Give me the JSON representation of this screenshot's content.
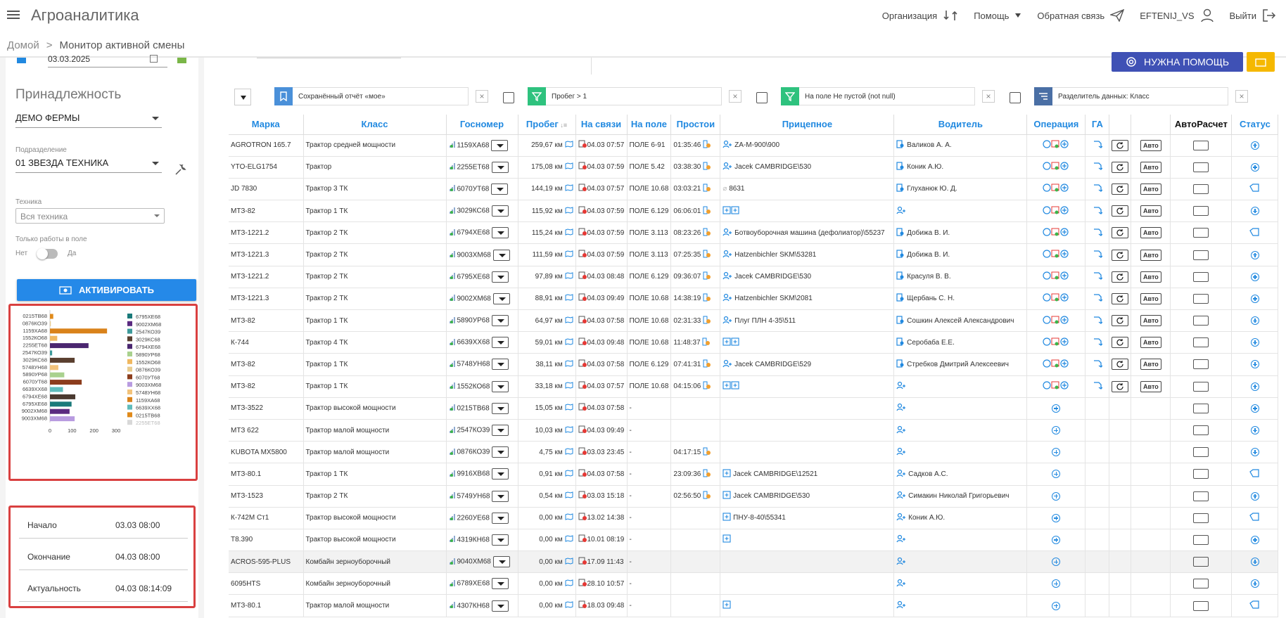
{
  "app": {
    "title": "Агроаналитика"
  },
  "topnav": {
    "org": "Организация",
    "help": "Помощь",
    "feedback": "Обратная связь",
    "user": "EFTENIJ_VS",
    "logout": "Выйти"
  },
  "breadcrumb": {
    "home": "Домой",
    "current": "Монитор активной смены"
  },
  "sidebar": {
    "date": "03.03.2025",
    "section_title": "Принадлежность",
    "farm": "ДЕМО ФЕРМЫ",
    "division_label": "Подразделение",
    "division": "01 ЗВЕЗДА ТЕХНИКА",
    "tech_label": "Техника",
    "tech": "Вся техника",
    "only_field_label": "Только работы в поле",
    "no": "Нет",
    "yes": "Да",
    "activate": "АКТИВИРОВАТЬ",
    "info": {
      "start_label": "Начало",
      "start": "03.03 08:00",
      "end_label": "Окончание",
      "end": "04.03 08:00",
      "actual_label": "Актуальность",
      "actual": "04.03 08:14:09"
    }
  },
  "chart_data": {
    "type": "bar",
    "orientation": "horizontal",
    "categories": [
      "0215ТВ68",
      "0876КО39",
      "1159ХА68",
      "1552КО68",
      "2255ЕТ68",
      "2547КО39",
      "3029КС68",
      "5748УН68",
      "5890УР68",
      "6070УТ68",
      "6639ХХ68",
      "6794ХЕ68",
      "6795ХЕ68",
      "9002ХМ68",
      "9003ХМ68"
    ],
    "values": [
      15,
      4,
      259,
      33,
      175,
      10,
      112,
      38,
      65,
      144,
      59,
      115,
      98,
      89,
      112
    ],
    "colors": [
      "#e08a1a",
      "#e8cc8f",
      "#d9821b",
      "#f0b860",
      "#4a2670",
      "#3d9a9a",
      "#5a3f2f",
      "#f3c37b",
      "#a9d18e",
      "#8c3d1d",
      "#5fbcbc",
      "#4a3a30",
      "#1a7a7a",
      "#5a2a80",
      "#b89be0"
    ],
    "xlim": [
      0,
      300
    ],
    "xticks": [
      "0",
      "100",
      "200",
      "300"
    ],
    "legend": [
      "6795ХЕ68",
      "9002ХМ68",
      "2547КО39",
      "3029КС68",
      "6794ХЕ68",
      "5890УР68",
      "1552КО68",
      "0876КО39",
      "6070УТ68",
      "9003ХМ68",
      "5748УН68",
      "1159ХА68",
      "6639ХХ68",
      "0215ТВ68",
      "2255ЕТ68"
    ],
    "legend_colors": [
      "#1a7a7a",
      "#5a2a80",
      "#3d9a9a",
      "#5a3f2f",
      "#4a2670",
      "#a9d18e",
      "#f0b860",
      "#e8cc8f",
      "#8c3d1d",
      "#b89be0",
      "#f3c37b",
      "#d9821b",
      "#5fbcbc",
      "#e08a1a",
      "#d8d8d8"
    ]
  },
  "main": {
    "help_button": "НУЖНА ПОМОЩЬ",
    "filters": [
      {
        "text": "Сохранённый отчёт «мое»",
        "color": "#4a90d9"
      },
      {
        "text": "Пробег > 1",
        "color": "#2ec27e"
      },
      {
        "text": "На поле Не пустой (not null)",
        "color": "#2ec27e"
      },
      {
        "text": "Разделитель данных: Класс",
        "color": "#4a6fa5"
      }
    ],
    "columns": [
      "Марка",
      "Класс",
      "Госномер",
      "Пробег",
      "На связи",
      "На поле",
      "Простои",
      "Прицепное",
      "Водитель",
      "Операция",
      "ГА",
      "",
      "",
      "АвтоРасчет",
      "Статус"
    ],
    "auto_label": "Авто",
    "rows": [
      {
        "marka": "AGROTRON 165.7",
        "klass": "Трактор средней мощности",
        "nomer": "1159ХА68",
        "probeg": "259,67 км",
        "svyaz": "04.03 07:57",
        "pole": "ПОЛЕ 6-91",
        "prostoi": "01:35:46",
        "pritsep": "ZA-M-900\\900",
        "voditel": "Валиков А. А.",
        "full": true
      },
      {
        "marka": "YTO-ELG1754",
        "klass": "Трактор",
        "nomer": "2255ЕТ68",
        "probeg": "175,08 км",
        "svyaz": "04.03 07:59",
        "pole": "ПОЛЕ 5.42",
        "prostoi": "03:38:30",
        "pritsep": "Jacek CAMBRIDGE\\530",
        "voditel": "Коник А.Ю.",
        "full": true
      },
      {
        "marka": "JD 7830",
        "klass": "Трактор 3 ТК",
        "nomer": "6070УТ68",
        "probeg": "144,19 км",
        "svyaz": "04.03 07:57",
        "pole": "ПОЛЕ 10.68",
        "prostoi": "03:03:21",
        "pritsep": "8631",
        "voditel": "Глуханюк Ю. Д.",
        "full": true,
        "tag": true
      },
      {
        "marka": "МТЗ-82",
        "klass": "Трактор 1 ТК",
        "nomer": "3029КС68",
        "probeg": "115,92 км",
        "svyaz": "04.03 07:59",
        "pole": "ПОЛЕ 6.129",
        "prostoi": "06:06:01",
        "pritsep": "",
        "voditel": "",
        "full": true
      },
      {
        "marka": "МТЗ-1221.2",
        "klass": "Трактор 2 ТК",
        "nomer": "6794ХЕ68",
        "probeg": "115,24 км",
        "svyaz": "04.03 07:59",
        "pole": "ПОЛЕ 3.113",
        "prostoi": "08:23:26",
        "pritsep": "Ботвоуборочная машина (дефолиатор)\\55237",
        "voditel": "Добижа В. И.",
        "full": true,
        "tag": true
      },
      {
        "marka": "МТЗ-1221.3",
        "klass": "Трактор 2 ТК",
        "nomer": "9003ХМ68",
        "probeg": "111,59 км",
        "svyaz": "04.03 07:59",
        "pole": "ПОЛЕ 3.113",
        "prostoi": "07:25:35",
        "pritsep": "Hatzenbichler SKM\\53281",
        "voditel": "Добижа В. И.",
        "full": true
      },
      {
        "marka": "МТЗ-1221.2",
        "klass": "Трактор 2 ТК",
        "nomer": "6795ХЕ68",
        "probeg": "97,89 км",
        "svyaz": "04.03 08:48",
        "pole": "ПОЛЕ 6.129",
        "prostoi": "09:36:07",
        "pritsep": "Jacek CAMBRIDGE\\530",
        "voditel": "Красуля В. В.",
        "full": true
      },
      {
        "marka": "МТЗ-1221.3",
        "klass": "Трактор 2 ТК",
        "nomer": "9002ХМ68",
        "probeg": "88,91 км",
        "svyaz": "04.03 09:49",
        "pole": "ПОЛЕ 10.68",
        "prostoi": "14:38:19",
        "pritsep": "Hatzenbichler SKM\\2081",
        "voditel": "Щербань С. Н.",
        "full": true
      },
      {
        "marka": "МТЗ-82",
        "klass": "Трактор 1 ТК",
        "nomer": "5890УР68",
        "probeg": "64,97 км",
        "svyaz": "04.03 07:58",
        "pole": "ПОЛЕ 10.68",
        "prostoi": "02:31:33",
        "pritsep": "Плуг ПЛН 4-35\\511",
        "voditel": "Сошкин Алексей Александрович",
        "full": true
      },
      {
        "marka": "К-744",
        "klass": "Трактор 4 ТК",
        "nomer": "6639ХХ68",
        "probeg": "59,01 км",
        "svyaz": "04.03 09:48",
        "pole": "ПОЛЕ 10.68",
        "prostoi": "11:48:37",
        "pritsep": "",
        "voditel": "Серобаба Е.Е.",
        "full": true
      },
      {
        "marka": "МТЗ-82",
        "klass": "Трактор 1 ТК",
        "nomer": "5748УН68",
        "probeg": "38,11 км",
        "svyaz": "04.03 07:58",
        "pole": "ПОЛЕ 6.129",
        "prostoi": "07:41:31",
        "pritsep": "Jacek CAMBRIDGE\\529",
        "voditel": "Стребков Дмитрий Алексеевич",
        "full": true
      },
      {
        "marka": "МТЗ-82",
        "klass": "Трактор 1 ТК",
        "nomer": "1552КО68",
        "probeg": "33,18 км",
        "svyaz": "04.03 07:57",
        "pole": "ПОЛЕ 10.68",
        "prostoi": "04:15:06",
        "pritsep": "",
        "voditel": "",
        "full": true
      },
      {
        "marka": "МТЗ-3522",
        "klass": "Трактор высокой мощности",
        "nomer": "0215ТВ68",
        "probeg": "15,05 км",
        "svyaz": "04.03 07:58",
        "pole": "-",
        "prostoi": "",
        "pritsep": "",
        "voditel": "",
        "full": false
      },
      {
        "marka": "МТЗ 622",
        "klass": "Трактор малой мощности",
        "nomer": "2547КО39",
        "probeg": "10,03 км",
        "svyaz": "04.03 09:49",
        "pole": "-",
        "prostoi": "",
        "pritsep": "",
        "voditel": "",
        "full": false
      },
      {
        "marka": "KUBOTA MX5800",
        "klass": "Трактор малой мощности",
        "nomer": "0876КО39",
        "probeg": "4,75 км",
        "svyaz": "03.03 23:45",
        "pole": "-",
        "prostoi": "04:17:15",
        "pritsep": "",
        "voditel": "",
        "full": false
      },
      {
        "marka": "МТЗ-80.1",
        "klass": "Трактор 1 ТК",
        "nomer": "9916ХВ68",
        "probeg": "0,91 км",
        "svyaz": "04.03 07:58",
        "pole": "-",
        "prostoi": "23:09:36",
        "pritsep": "Jacek CAMBRIDGE\\12521",
        "voditel": "Садков А.С.",
        "full": false,
        "tag": true
      },
      {
        "marka": "МТЗ-1523",
        "klass": "Трактор 2 ТК",
        "nomer": "5749УН68",
        "probeg": "0,54 км",
        "svyaz": "03.03 15:18",
        "pole": "-",
        "prostoi": "02:56:50",
        "pritsep": "Jacek CAMBRIDGE\\530",
        "voditel": "Симакин Николай Григорьевич",
        "full": false
      },
      {
        "marka": "К-742М Ст1",
        "klass": "Трактор высокой мощности",
        "nomer": "2260УЕ68",
        "probeg": "0,00 км",
        "svyaz": "13.02 14:38",
        "pole": "-",
        "prostoi": "",
        "pritsep": "ПНУ-8-40\\55341",
        "voditel": "Коник А.Ю.",
        "full": false,
        "tag": true
      },
      {
        "marka": "T8.390",
        "klass": "Трактор высокой мощности",
        "nomer": "4319КН68",
        "probeg": "0,00 км",
        "svyaz": "10.01 08:19",
        "pole": "-",
        "prostoi": "",
        "pritsep": "",
        "voditel": "",
        "full": false
      },
      {
        "marka": "ACROS-595-PLUS",
        "klass": "Комбайн зерноуборочный",
        "nomer": "9040ХМ68",
        "probeg": "0,00 км",
        "svyaz": "17.09 11:43",
        "pole": "-",
        "prostoi": "",
        "pritsep": "",
        "voditel": "",
        "full": false,
        "hl": true
      },
      {
        "marka": "6095HTS",
        "klass": "Комбайн зерноуборочный",
        "nomer": "6789ХЕ68",
        "probeg": "0,00 км",
        "svyaz": "28.10 10:57",
        "pole": "-",
        "prostoi": "",
        "pritsep": "",
        "voditel": "",
        "full": false
      },
      {
        "marka": "МТЗ-80.1",
        "klass": "Трактор малой мощности",
        "nomer": "4307КН68",
        "probeg": "0,00 км",
        "svyaz": "18.03 09:48",
        "pole": "-",
        "prostoi": "",
        "pritsep": "",
        "voditel": "",
        "full": false,
        "tag": true
      }
    ]
  }
}
